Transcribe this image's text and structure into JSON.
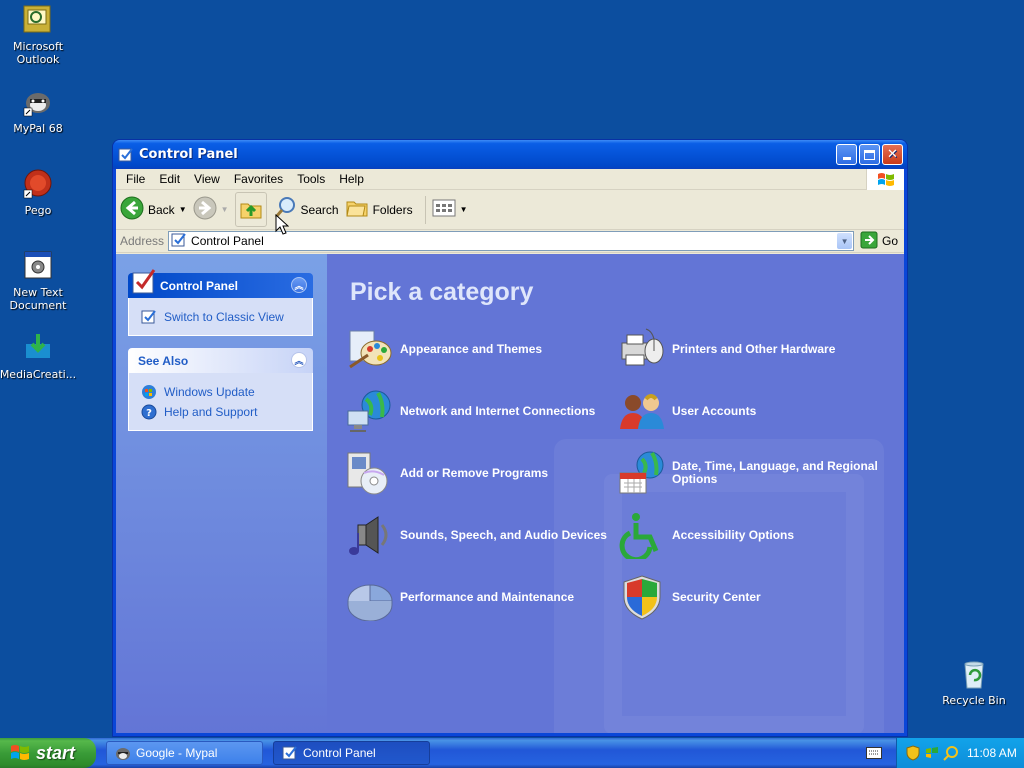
{
  "desktop": {
    "icons": [
      {
        "label": "Microsoft Outlook"
      },
      {
        "label": "MyPal 68"
      },
      {
        "label": "Pego"
      },
      {
        "label": "New Text Document"
      },
      {
        "label": "MediaCreati..."
      },
      {
        "label": "Recycle Bin"
      }
    ]
  },
  "window": {
    "title": "Control Panel",
    "menu": [
      "File",
      "Edit",
      "View",
      "Favorites",
      "Tools",
      "Help"
    ],
    "toolbar": {
      "back_label": "Back",
      "search_label": "Search",
      "folders_label": "Folders"
    },
    "address": {
      "label": "Address",
      "value": "Control Panel",
      "go_label": "Go"
    },
    "sidepane": {
      "control_panel_header": "Control Panel",
      "switch_label": "Switch to Classic View",
      "see_also_header": "See Also",
      "see_also_links": [
        "Windows Update",
        "Help and Support"
      ]
    },
    "main": {
      "heading": "Pick a category",
      "categories": [
        {
          "label": "Appearance and Themes",
          "icon": "appearance-themes-icon"
        },
        {
          "label": "Printers and Other Hardware",
          "icon": "printers-hardware-icon"
        },
        {
          "label": "Network and Internet Connections",
          "icon": "network-internet-icon"
        },
        {
          "label": "User Accounts",
          "icon": "user-accounts-icon"
        },
        {
          "label": "Add or Remove Programs",
          "icon": "add-remove-programs-icon"
        },
        {
          "label": "Date, Time, Language, and Regional Options",
          "icon": "date-time-regional-icon"
        },
        {
          "label": "Sounds, Speech, and Audio Devices",
          "icon": "sounds-audio-icon"
        },
        {
          "label": "Accessibility Options",
          "icon": "accessibility-icon"
        },
        {
          "label": "Performance and Maintenance",
          "icon": "performance-maintenance-icon"
        },
        {
          "label": "Security Center",
          "icon": "security-center-icon"
        }
      ]
    }
  },
  "taskbar": {
    "start_label": "start",
    "tasks": [
      {
        "label": "Google - Mypal",
        "active": false
      },
      {
        "label": "Control Panel",
        "active": true
      }
    ],
    "clock": "11:08 AM"
  },
  "colors": {
    "desktop": "#0c4e9f",
    "category_pane": "#6375d6",
    "title_bar": "#0553d8"
  }
}
